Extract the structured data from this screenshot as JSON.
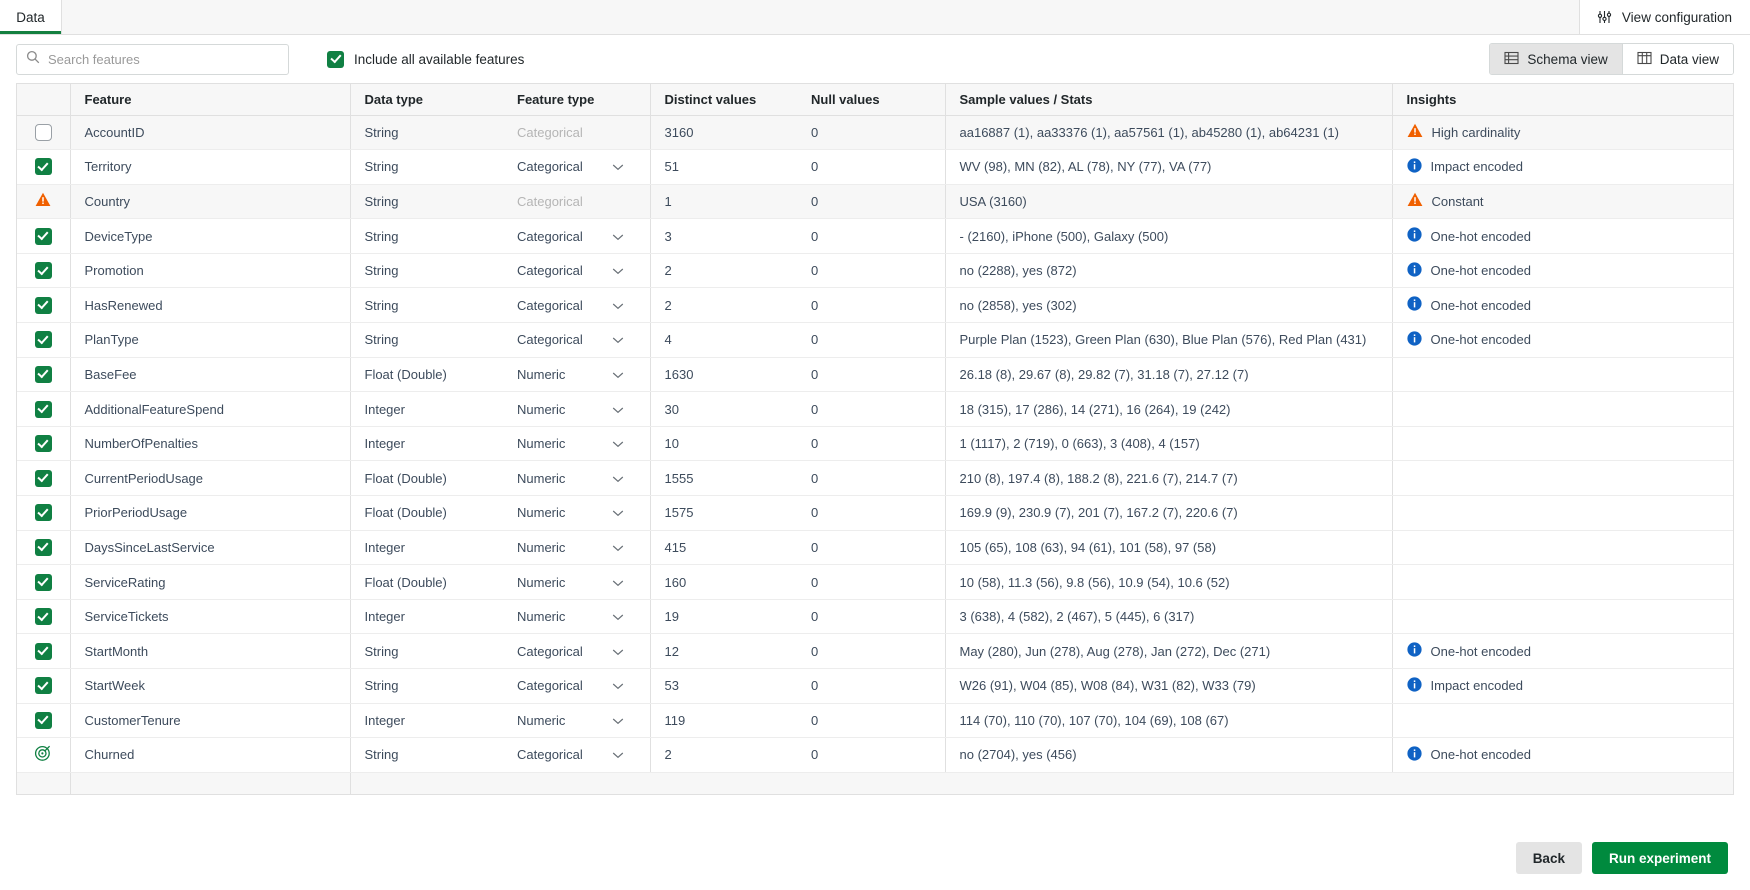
{
  "topbar": {
    "tabs": [
      {
        "label": "Data",
        "active": true
      }
    ],
    "view_configuration_label": "View configuration",
    "view_configuration_icon": "sliders-icon"
  },
  "toolbar": {
    "search_placeholder": "Search features",
    "search_value": "",
    "search_icon": "search-icon",
    "include_all_label": "Include all available features",
    "include_all_checked": true,
    "schema_view_label": "Schema view",
    "data_view_label": "Data view",
    "selected_view": "Schema view"
  },
  "table": {
    "columns": [
      "Feature",
      "Data type",
      "Feature type",
      "Distinct values",
      "Null values",
      "Sample values / Stats",
      "Insights"
    ],
    "rows": [
      {
        "selector": "checkbox-off",
        "feature": "AccountID",
        "data_type": "String",
        "feature_type": "Categorical",
        "feature_type_disabled": true,
        "distinct_values": "3160",
        "null_values": "0",
        "sample_values": "aa16887 (1), aa33376 (1), aa57561 (1), ab45280 (1), ab64231 (1)",
        "insight": "High cardinality",
        "insight_icon": "warning-triangle-icon",
        "dim": true
      },
      {
        "selector": "checkbox-on",
        "feature": "Territory",
        "data_type": "String",
        "feature_type": "Categorical",
        "feature_type_disabled": false,
        "distinct_values": "51",
        "null_values": "0",
        "sample_values": "WV (98), MN (82), AL (78), NY (77), VA (77)",
        "insight": "Impact encoded",
        "insight_icon": "info-circle-icon",
        "dim": false
      },
      {
        "selector": "warning",
        "feature": "Country",
        "data_type": "String",
        "feature_type": "Categorical",
        "feature_type_disabled": true,
        "distinct_values": "1",
        "null_values": "0",
        "sample_values": "USA (3160)",
        "insight": "Constant",
        "insight_icon": "warning-triangle-icon",
        "dim": true
      },
      {
        "selector": "checkbox-on",
        "feature": "DeviceType",
        "data_type": "String",
        "feature_type": "Categorical",
        "feature_type_disabled": false,
        "distinct_values": "3",
        "null_values": "0",
        "sample_values": "- (2160), iPhone (500), Galaxy (500)",
        "insight": "One-hot encoded",
        "insight_icon": "info-circle-icon",
        "dim": false
      },
      {
        "selector": "checkbox-on",
        "feature": "Promotion",
        "data_type": "String",
        "feature_type": "Categorical",
        "feature_type_disabled": false,
        "distinct_values": "2",
        "null_values": "0",
        "sample_values": "no (2288), yes (872)",
        "insight": "One-hot encoded",
        "insight_icon": "info-circle-icon",
        "dim": false
      },
      {
        "selector": "checkbox-on",
        "feature": "HasRenewed",
        "data_type": "String",
        "feature_type": "Categorical",
        "feature_type_disabled": false,
        "distinct_values": "2",
        "null_values": "0",
        "sample_values": "no (2858), yes (302)",
        "insight": "One-hot encoded",
        "insight_icon": "info-circle-icon",
        "dim": false
      },
      {
        "selector": "checkbox-on",
        "feature": "PlanType",
        "data_type": "String",
        "feature_type": "Categorical",
        "feature_type_disabled": false,
        "distinct_values": "4",
        "null_values": "0",
        "sample_values": "Purple Plan (1523), Green Plan (630), Blue Plan (576), Red Plan (431)",
        "insight": "One-hot encoded",
        "insight_icon": "info-circle-icon",
        "dim": false
      },
      {
        "selector": "checkbox-on",
        "feature": "BaseFee",
        "data_type": "Float (Double)",
        "feature_type": "Numeric",
        "feature_type_disabled": false,
        "distinct_values": "1630",
        "null_values": "0",
        "sample_values": "26.18 (8), 29.67 (8), 29.82 (7), 31.18 (7), 27.12 (7)",
        "insight": "",
        "insight_icon": "",
        "dim": false
      },
      {
        "selector": "checkbox-on",
        "feature": "AdditionalFeatureSpend",
        "data_type": "Integer",
        "feature_type": "Numeric",
        "feature_type_disabled": false,
        "distinct_values": "30",
        "null_values": "0",
        "sample_values": "18 (315), 17 (286), 14 (271), 16 (264), 19 (242)",
        "insight": "",
        "insight_icon": "",
        "dim": false
      },
      {
        "selector": "checkbox-on",
        "feature": "NumberOfPenalties",
        "data_type": "Integer",
        "feature_type": "Numeric",
        "feature_type_disabled": false,
        "distinct_values": "10",
        "null_values": "0",
        "sample_values": "1 (1117), 2 (719), 0 (663), 3 (408), 4 (157)",
        "insight": "",
        "insight_icon": "",
        "dim": false
      },
      {
        "selector": "checkbox-on",
        "feature": "CurrentPeriodUsage",
        "data_type": "Float (Double)",
        "feature_type": "Numeric",
        "feature_type_disabled": false,
        "distinct_values": "1555",
        "null_values": "0",
        "sample_values": "210 (8), 197.4 (8), 188.2 (8), 221.6 (7), 214.7 (7)",
        "insight": "",
        "insight_icon": "",
        "dim": false
      },
      {
        "selector": "checkbox-on",
        "feature": "PriorPeriodUsage",
        "data_type": "Float (Double)",
        "feature_type": "Numeric",
        "feature_type_disabled": false,
        "distinct_values": "1575",
        "null_values": "0",
        "sample_values": "169.9 (9), 230.9 (7), 201 (7), 167.2 (7), 220.6 (7)",
        "insight": "",
        "insight_icon": "",
        "dim": false
      },
      {
        "selector": "checkbox-on",
        "feature": "DaysSinceLastService",
        "data_type": "Integer",
        "feature_type": "Numeric",
        "feature_type_disabled": false,
        "distinct_values": "415",
        "null_values": "0",
        "sample_values": "105 (65), 108 (63), 94 (61), 101 (58), 97 (58)",
        "insight": "",
        "insight_icon": "",
        "dim": false
      },
      {
        "selector": "checkbox-on",
        "feature": "ServiceRating",
        "data_type": "Float (Double)",
        "feature_type": "Numeric",
        "feature_type_disabled": false,
        "distinct_values": "160",
        "null_values": "0",
        "sample_values": "10 (58), 11.3 (56), 9.8 (56), 10.9 (54), 10.6 (52)",
        "insight": "",
        "insight_icon": "",
        "dim": false
      },
      {
        "selector": "checkbox-on",
        "feature": "ServiceTickets",
        "data_type": "Integer",
        "feature_type": "Numeric",
        "feature_type_disabled": false,
        "distinct_values": "19",
        "null_values": "0",
        "sample_values": "3 (638), 4 (582), 2 (467), 5 (445), 6 (317)",
        "insight": "",
        "insight_icon": "",
        "dim": false
      },
      {
        "selector": "checkbox-on",
        "feature": "StartMonth",
        "data_type": "String",
        "feature_type": "Categorical",
        "feature_type_disabled": false,
        "distinct_values": "12",
        "null_values": "0",
        "sample_values": "May (280), Jun (278), Aug (278), Jan (272), Dec (271)",
        "insight": "One-hot encoded",
        "insight_icon": "info-circle-icon",
        "dim": false
      },
      {
        "selector": "checkbox-on",
        "feature": "StartWeek",
        "data_type": "String",
        "feature_type": "Categorical",
        "feature_type_disabled": false,
        "distinct_values": "53",
        "null_values": "0",
        "sample_values": "W26 (91), W04 (85), W08 (84), W31 (82), W33 (79)",
        "insight": "Impact encoded",
        "insight_icon": "info-circle-icon",
        "dim": false
      },
      {
        "selector": "checkbox-on",
        "feature": "CustomerTenure",
        "data_type": "Integer",
        "feature_type": "Numeric",
        "feature_type_disabled": false,
        "distinct_values": "119",
        "null_values": "0",
        "sample_values": "114 (70), 110 (70), 107 (70), 104 (69), 108 (67)",
        "insight": "",
        "insight_icon": "",
        "dim": false
      },
      {
        "selector": "target",
        "feature": "Churned",
        "data_type": "String",
        "feature_type": "Categorical",
        "feature_type_disabled": false,
        "distinct_values": "2",
        "null_values": "0",
        "sample_values": "no (2704), yes (456)",
        "insight": "One-hot encoded",
        "insight_icon": "info-circle-icon",
        "dim": false
      }
    ]
  },
  "footer": {
    "back_label": "Back",
    "run_label": "Run experiment"
  },
  "colors": {
    "accent_green": "#108043",
    "primary_button": "#008a3e",
    "warning_orange": "#f06000",
    "info_blue": "#0f62c4"
  }
}
